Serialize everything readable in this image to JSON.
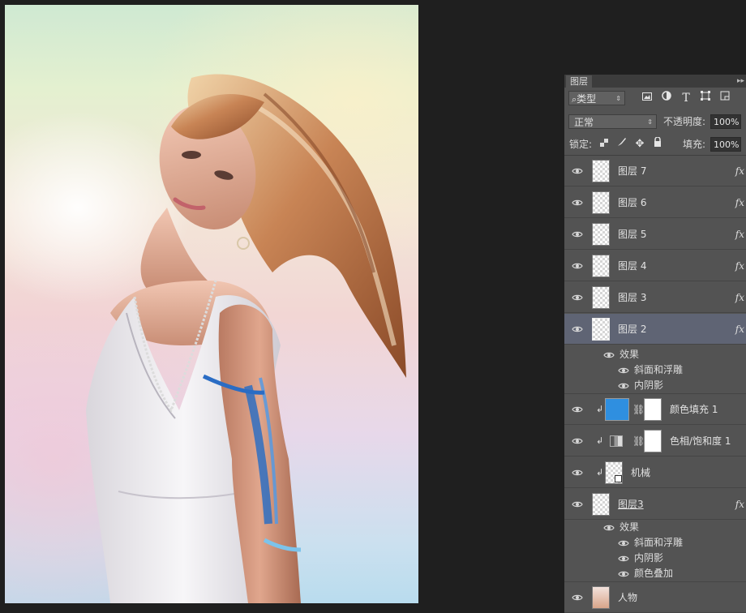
{
  "panel": {
    "tab_label": "图层",
    "menu_icon": "panel-menu-icon",
    "filter": {
      "label": "类型",
      "icon": "search-icon"
    },
    "filter_icons": [
      "image-filter-icon",
      "adjustment-filter-icon",
      "type-filter-icon",
      "shape-filter-icon",
      "smart-object-filter-icon"
    ],
    "blend_mode": "正常",
    "opacity_label": "不透明度:",
    "opacity_value": "100%",
    "lock_label": "锁定:",
    "lock_icons": [
      "lock-transparent-icon",
      "lock-image-icon",
      "lock-position-icon",
      "lock-all-icon"
    ],
    "fill_label": "填充:",
    "fill_value": "100%"
  },
  "layers": [
    {
      "name": "图层 7",
      "fx": "fx",
      "selected": false
    },
    {
      "name": "图层 6",
      "fx": "fx",
      "selected": false
    },
    {
      "name": "图层 5",
      "fx": "fx",
      "selected": false
    },
    {
      "name": "图层 4",
      "fx": "fx",
      "selected": false
    },
    {
      "name": "图层 3",
      "fx": "fx",
      "selected": false
    },
    {
      "name": "图层 2",
      "fx": "fx",
      "selected": true
    }
  ],
  "layer2_effects": {
    "label": "效果",
    "items": [
      "斜面和浮雕",
      "内阴影"
    ]
  },
  "fill_layer": {
    "name": "颜色填充 1",
    "color": "#2f8fe0"
  },
  "hue_layer": {
    "name": "色相/饱和度 1"
  },
  "machine_layer": {
    "name": "机械"
  },
  "layer_3b": {
    "name": "图层3",
    "fx": "fx"
  },
  "layer_3b_effects": {
    "label": "效果",
    "items": [
      "斜面和浮雕",
      "内阴影",
      "颜色叠加"
    ]
  },
  "person_layer": {
    "name": "人物"
  }
}
